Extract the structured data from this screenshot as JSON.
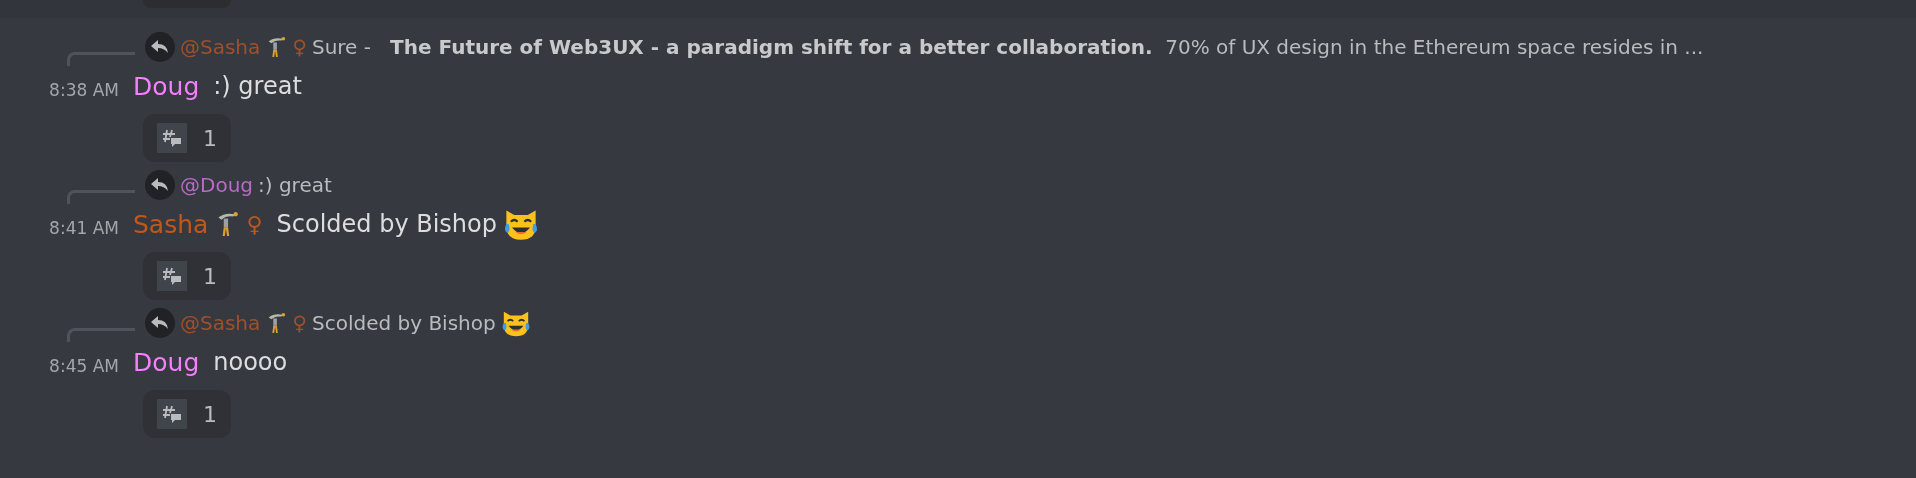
{
  "messages": [
    {
      "reply": {
        "mention": "@Sasha",
        "color": "#a0502a",
        "gymnast_badge": true,
        "gender": "♀",
        "text": "Sure -   **The Future of Web3UX - a paradigm shift for a better collaboration.**  70% of UX design in the Ethereum space resides in ..."
      },
      "time": "8:38 AM",
      "author": "Doug",
      "color": "#f47fff",
      "text": ":) great",
      "thread_count": "1"
    },
    {
      "reply": {
        "mention": "@Doug",
        "color": "#b86ac8",
        "text": ":) great"
      },
      "time": "8:41 AM",
      "author": "Sasha",
      "color": "#c2571a",
      "gymnast_badge": true,
      "gender": "♀",
      "text": "Scolded by Bishop",
      "laughing_cat": true,
      "thread_count": "1"
    },
    {
      "reply": {
        "mention": "@Sasha",
        "color": "#a0502a",
        "gymnast_badge": true,
        "gender": "♀",
        "text": "Scolded by Bishop",
        "laughing_cat": true
      },
      "time": "8:45 AM",
      "author": "Doug",
      "color": "#f47fff",
      "text": "noooo",
      "thread_count": "1"
    }
  ]
}
